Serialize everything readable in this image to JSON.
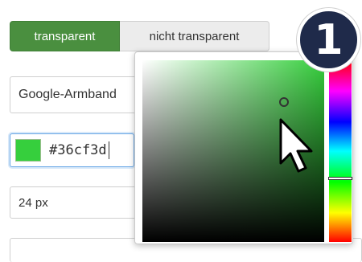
{
  "background_toggle": {
    "options": [
      {
        "label": "transparent",
        "selected": true
      },
      {
        "label": "nicht transparent",
        "selected": false
      }
    ]
  },
  "font_select": {
    "value": "Google-Armband"
  },
  "color_field": {
    "value": "#36cf3d",
    "swatch_color": "#36cf3d"
  },
  "size_select": {
    "value": "24 px"
  },
  "color_picker": {
    "hue_color": "#36cf3d",
    "icon": "mouse-pointer-icon"
  },
  "step_badge": {
    "number": "1"
  },
  "colors": {
    "accent_green": "#4a8f3f",
    "badge_navy": "#1f2a4a"
  }
}
